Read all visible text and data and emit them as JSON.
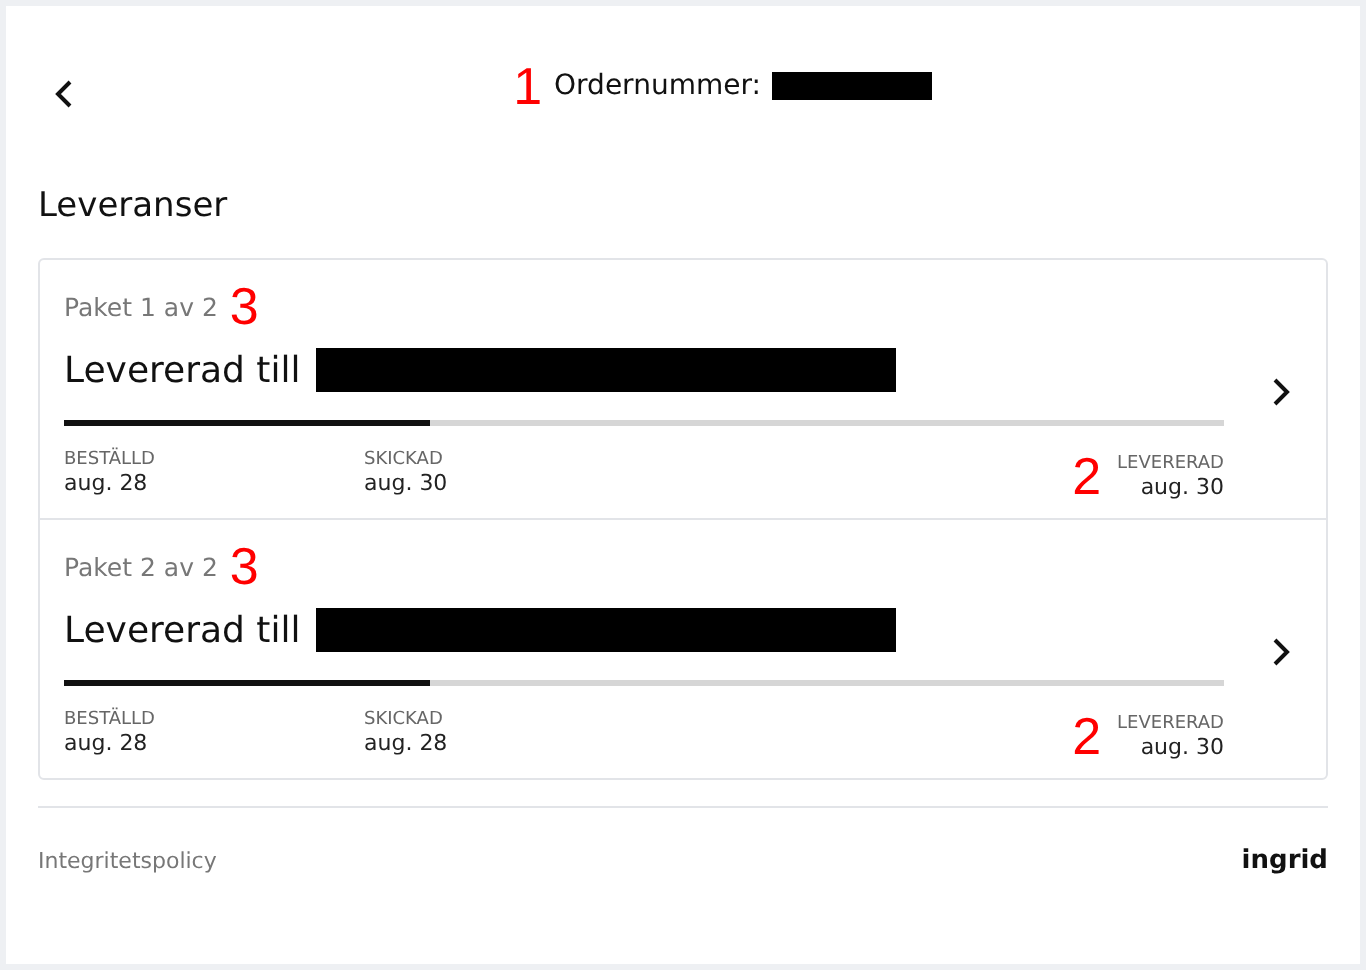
{
  "header": {
    "title": "Ordernummer:",
    "marker": "1"
  },
  "section_title": "Leveranser",
  "packages": [
    {
      "label": "Paket 1 av 2",
      "marker": "3",
      "status": "Levererad till",
      "level": 0.315,
      "steps": [
        {
          "name": "BESTÄLLD",
          "date": "aug. 28"
        },
        {
          "name": "SKICKAD",
          "date": "aug. 30"
        },
        {
          "name": "LEVERERAD",
          "date": "aug. 30",
          "marker": "2"
        }
      ]
    },
    {
      "label": "Paket 2 av 2",
      "marker": "3",
      "status": "Levererad till",
      "level": 0.315,
      "steps": [
        {
          "name": "BESTÄLLD",
          "date": "aug. 28"
        },
        {
          "name": "SKICKAD",
          "date": "aug. 28"
        },
        {
          "name": "LEVERERAD",
          "date": "aug. 30",
          "marker": "2"
        }
      ]
    }
  ],
  "footer": {
    "link": "Integritetspolicy",
    "brand": "ingrid"
  }
}
